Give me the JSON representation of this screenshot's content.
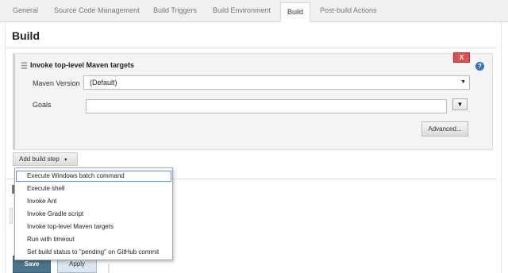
{
  "tabs": [
    {
      "label": "General"
    },
    {
      "label": "Source Code Management"
    },
    {
      "label": "Build Triggers"
    },
    {
      "label": "Build Environment"
    },
    {
      "label": "Build",
      "active": true
    },
    {
      "label": "Post-build Actions"
    }
  ],
  "section": {
    "title": "Build"
  },
  "step": {
    "title": "Invoke top-level Maven targets",
    "delete_label": "X",
    "help_label": "?",
    "maven_version_label": "Maven Version",
    "maven_version_value": "(Default)",
    "goals_label": "Goals",
    "goals_value": "",
    "expand_label": "▼",
    "advanced_label": "Advanced..."
  },
  "add_step": {
    "label": "Add build step",
    "caret": "▼"
  },
  "menu": {
    "items": [
      {
        "label": "Execute Windows batch command",
        "focused": true
      },
      {
        "label": "Execute shell"
      },
      {
        "label": "Invoke Ant"
      },
      {
        "label": "Invoke Gradle script"
      },
      {
        "label": "Invoke top-level Maven targets"
      },
      {
        "label": "Run with timeout"
      },
      {
        "label": "Set build status to \"pending\" on GitHub commit"
      }
    ]
  },
  "footer": {
    "save_label": "Save",
    "apply_label": "Apply"
  },
  "colors": {
    "save": "#4b758b",
    "apply": "#dce6ee",
    "delete": "#d9534f",
    "help": "#2f74c9",
    "focus": "#4d90fe"
  }
}
